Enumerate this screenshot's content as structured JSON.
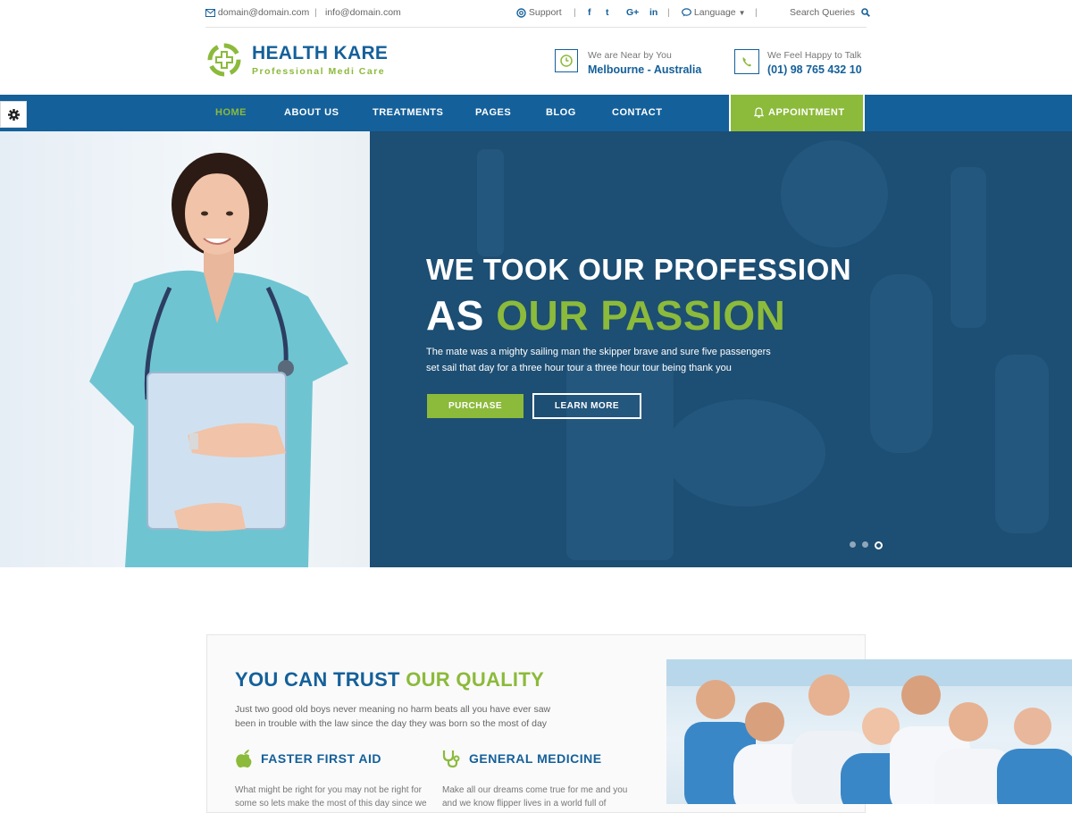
{
  "topbar": {
    "email1": "domain@domain.com",
    "email2": "info@domain.com",
    "support": "Support",
    "language": "Language",
    "search": "Search Queries",
    "social": [
      "f",
      "t",
      "G+",
      "in"
    ]
  },
  "header": {
    "logo_title": "HEALTH KARE",
    "logo_tagline": "Professional Medi Care",
    "location_label": "We are Near by You",
    "location_value": "Melbourne - Australia",
    "phone_label": "We Feel Happy to Talk",
    "phone_value": "(01) 98 765 432 10"
  },
  "nav": {
    "items": [
      "HOME",
      "ABOUT US",
      "TREATMENTS",
      "PAGES",
      "BLOG",
      "CONTACT"
    ],
    "active": "HOME",
    "appointment": "APPOINTMENT"
  },
  "hero": {
    "line1": "WE TOOK OUR PROFESSION",
    "line2_white": "AS ",
    "line2_green": "OUR PASSION",
    "paragraph": "The mate was a mighty sailing man the skipper brave and sure five passengers set sail that day for a three hour tour a three hour tour being thank you",
    "purchase": "PURCHASE",
    "learn_more": "LEARN MORE",
    "slide_count": 3,
    "active_slide": 3
  },
  "trust": {
    "title_blue": "YOU CAN TRUST ",
    "title_green": "OUR QUALITY",
    "paragraph": "Just two good old boys never meaning no harm beats all you have ever saw been in trouble with the law since the day they was born so the most of day",
    "feature1_title": "FASTER FIRST AID",
    "feature1_text": "What might be right for you may not be right for some so lets make the most of this day since we",
    "feature2_title": "GENERAL MEDICINE",
    "feature2_text": "Make all our dreams come true for me and you and we know flipper lives in a world full of"
  },
  "colors": {
    "brand_blue": "#14609a",
    "brand_green": "#8cba3b",
    "hero_overlay": "#1d4e73"
  }
}
